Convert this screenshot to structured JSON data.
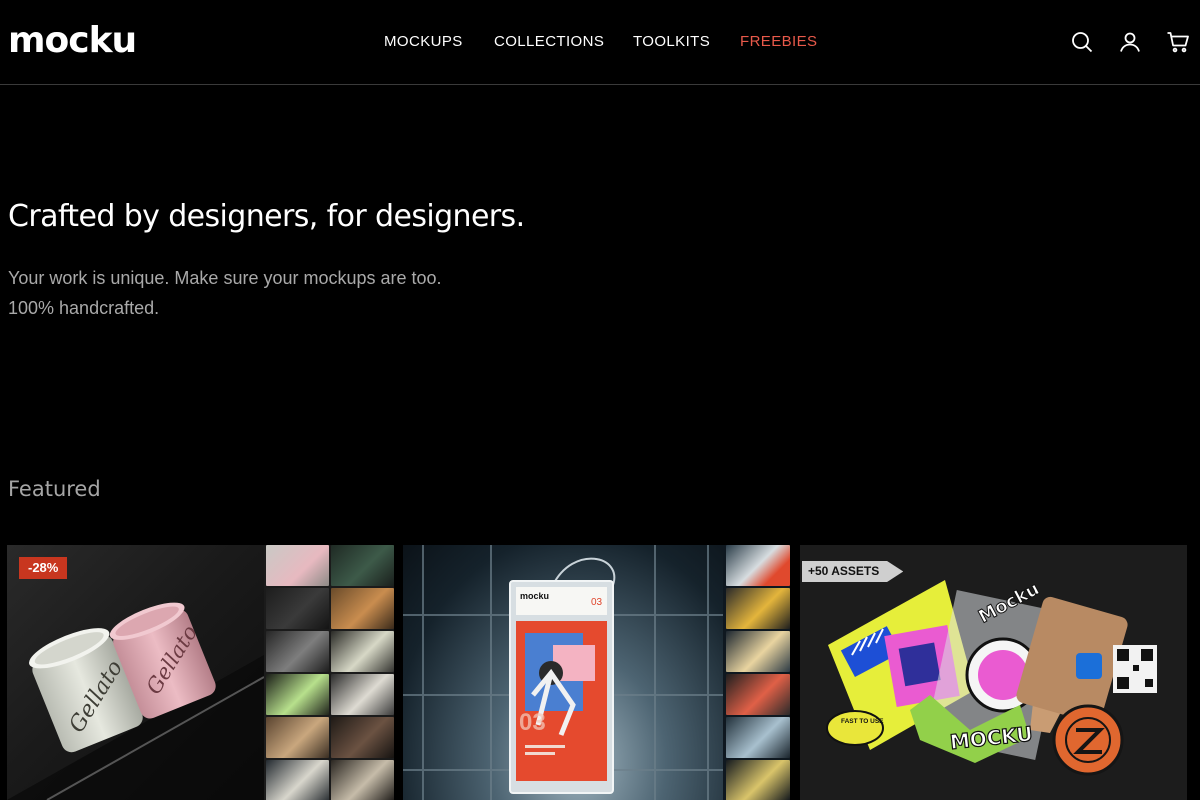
{
  "brand": {
    "logo": "mocku"
  },
  "nav": {
    "items": [
      {
        "label": "MOCKUPS",
        "color": "#ffffff"
      },
      {
        "label": "COLLECTIONS",
        "color": "#ffffff"
      },
      {
        "label": "TOOLKITS",
        "color": "#ffffff"
      },
      {
        "label": "FREEBIES",
        "color": "#e8594a"
      }
    ]
  },
  "header_icons": [
    "search-icon",
    "user-icon",
    "cart-icon"
  ],
  "hero": {
    "title": "Crafted by designers, for designers.",
    "subtitle_line1": "Your work is unique. Make sure your mockups are too.",
    "subtitle_line2": "100% handcrafted."
  },
  "featured": {
    "heading": "Featured",
    "cards": [
      {
        "badge": "-28%",
        "product_text_1": "Gellato",
        "product_text_2": "Gellato"
      },
      {
        "brand_label": "mocku",
        "number": "03"
      },
      {
        "badge": "+50 ASSETS",
        "sticker_text": "Mocku",
        "sticker_text_2": "MOCKU",
        "sticker_text_3": "FAST TO USE"
      }
    ]
  },
  "colors": {
    "accent": "#e8594a",
    "badge_red": "#c8361f",
    "background": "#000000"
  }
}
